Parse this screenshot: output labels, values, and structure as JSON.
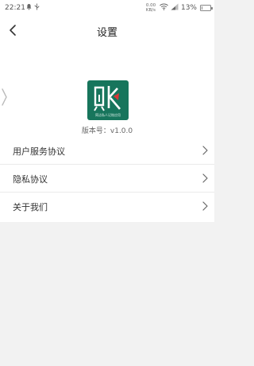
{
  "status_bar": {
    "time": "22:21",
    "net_speed_value": "0.00",
    "net_speed_unit": "KB/s",
    "battery_percent": "13%",
    "battery_level": 0.13,
    "icons": [
      "notification-icon",
      "usb-icon",
      "wifi-icon",
      "signal-icon",
      "battery-icon"
    ]
  },
  "nav": {
    "title": "设置",
    "back_icon": "chevron-left-icon"
  },
  "app": {
    "logo_text": "账",
    "logo_subtitle": "简洁私人记账应用",
    "brand_color": "#17755c",
    "version_label": "版本号：",
    "version_value": "v1.0.0"
  },
  "menu": [
    {
      "label": "用户服务协议",
      "icon": "chevron-right-icon"
    },
    {
      "label": "隐私协议",
      "icon": "chevron-right-icon"
    },
    {
      "label": "关于我们",
      "icon": "chevron-right-icon"
    }
  ]
}
